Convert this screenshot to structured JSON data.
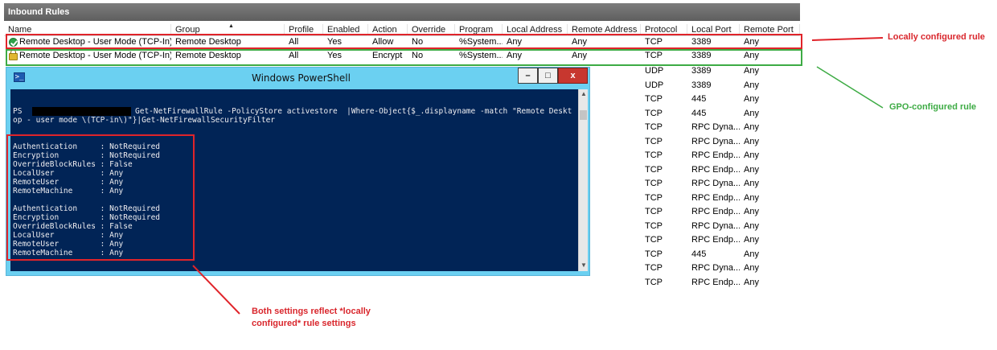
{
  "panel": {
    "title": "Inbound Rules",
    "columns": [
      "Name",
      "Group",
      "Profile",
      "Enabled",
      "Action",
      "Override",
      "Program",
      "Local Address",
      "Remote Address",
      "Protocol",
      "Local Port",
      "Remote Port"
    ]
  },
  "rules": [
    {
      "name": "Remote Desktop - User Mode (TCP-In)",
      "group": "Remote Desktop",
      "profile": "All",
      "enabled": "Yes",
      "action": "Allow",
      "override": "No",
      "program": "%System...",
      "local_address": "Any",
      "remote_address": "Any",
      "protocol": "TCP",
      "local_port": "3389",
      "remote_port": "Any",
      "icon": "allow-check-icon"
    },
    {
      "name": "Remote Desktop - User Mode (TCP-In)",
      "group": "Remote Desktop",
      "profile": "All",
      "enabled": "Yes",
      "action": "Encrypt",
      "override": "No",
      "program": "%System...",
      "local_address": "Any",
      "remote_address": "Any",
      "protocol": "TCP",
      "local_port": "3389",
      "remote_port": "Any",
      "icon": "lock-icon"
    }
  ],
  "partial_rows": [
    {
      "protocol": "UDP",
      "local_port": "3389",
      "remote_port": "Any"
    },
    {
      "protocol": "UDP",
      "local_port": "3389",
      "remote_port": "Any"
    },
    {
      "protocol": "TCP",
      "local_port": "445",
      "remote_port": "Any"
    },
    {
      "protocol": "TCP",
      "local_port": "445",
      "remote_port": "Any"
    },
    {
      "protocol": "TCP",
      "local_port": "RPC Dyna...",
      "remote_port": "Any"
    },
    {
      "protocol": "TCP",
      "local_port": "RPC Dyna...",
      "remote_port": "Any"
    },
    {
      "protocol": "TCP",
      "local_port": "RPC Endp...",
      "remote_port": "Any"
    },
    {
      "protocol": "TCP",
      "local_port": "RPC Endp...",
      "remote_port": "Any"
    },
    {
      "protocol": "TCP",
      "local_port": "RPC Dyna...",
      "remote_port": "Any"
    },
    {
      "protocol": "TCP",
      "local_port": "RPC Endp...",
      "remote_port": "Any"
    },
    {
      "protocol": "TCP",
      "local_port": "RPC Endp...",
      "remote_port": "Any"
    },
    {
      "protocol": "TCP",
      "local_port": "RPC Dyna...",
      "remote_port": "Any"
    },
    {
      "protocol": "TCP",
      "local_port": "RPC Endp...",
      "remote_port": "Any"
    },
    {
      "protocol": "TCP",
      "local_port": "445",
      "remote_port": "Any"
    },
    {
      "protocol": "TCP",
      "local_port": "RPC Dyna...",
      "remote_port": "Any"
    },
    {
      "protocol": "TCP",
      "local_port": "RPC Endp...",
      "remote_port": "Any"
    }
  ],
  "powershell": {
    "title": "Windows PowerShell",
    "buttons": {
      "minimize": "–",
      "maximize": "□",
      "close": "x"
    },
    "icon": "powershell-icon",
    "prompt": "PS",
    "command_line_1": "Get-NetFirewallRule -PolicyStore activestore  |Where-Object{$_.displayname -match \"Remote Deskt",
    "command_line_2": "op - user mode \\(TCP-in\\)\"}|Get-NetFirewallSecurityFilter",
    "output_blocks": [
      [
        "Authentication     : NotRequired",
        "Encryption         : NotRequired",
        "OverrideBlockRules : False",
        "LocalUser          : Any",
        "RemoteUser         : Any",
        "RemoteMachine      : Any"
      ],
      [
        "Authentication     : NotRequired",
        "Encryption         : NotRequired",
        "OverrideBlockRules : False",
        "LocalUser          : Any",
        "RemoteUser         : Any",
        "RemoteMachine      : Any"
      ]
    ]
  },
  "annotations": {
    "local": "Locally configured rule",
    "gpo": "GPO-configured rule",
    "both_line_1": "Both settings reflect *locally",
    "both_line_2": "configured* rule settings"
  },
  "colors": {
    "red": "#e0242a",
    "green": "#3dab44",
    "console_bg": "#012456",
    "titlebar": "#6bd0f1"
  }
}
